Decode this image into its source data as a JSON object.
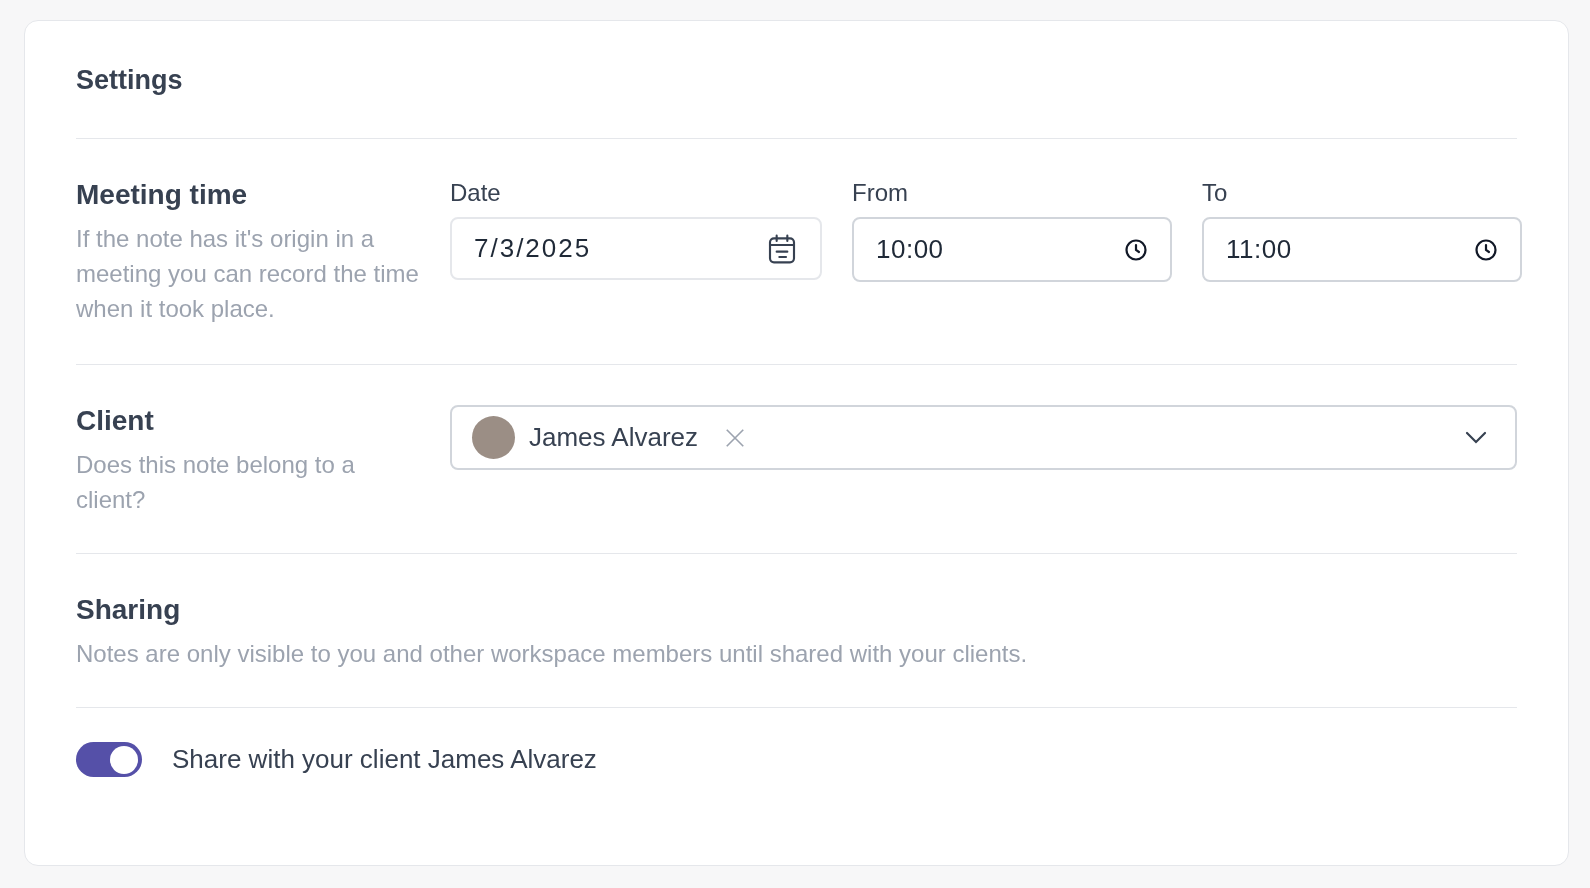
{
  "title": "Settings",
  "meeting": {
    "heading": "Meeting time",
    "description": "If the note has it's origin in a meeting you can record the time when it took place.",
    "fields": [
      {
        "kind": "date",
        "label": "Date",
        "value": "7/3/2025"
      },
      {
        "kind": "time",
        "label": "From",
        "value": "10:00"
      },
      {
        "kind": "time",
        "label": "To",
        "value": "11:00"
      }
    ]
  },
  "client": {
    "heading": "Client",
    "description": "Does this note belong to a client?",
    "selected_client": "James Alvarez"
  },
  "sharing": {
    "heading": "Sharing",
    "description": "Notes are only visible to you and other workspace members until shared with your clients."
  },
  "share_toggle": {
    "label": "Share with your client James Alvarez",
    "on": true
  }
}
